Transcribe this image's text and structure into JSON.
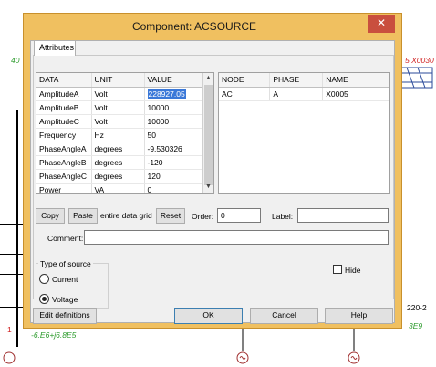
{
  "background": {
    "left_top_label": "40",
    "right_top_label_red": "5  X0030",
    "right_bottom_label_1": "220-2",
    "right_bottom_label_2": "3E9",
    "left_bottom_label": "-6.E6+j6.8E5",
    "left_marker": "1"
  },
  "dialog": {
    "title": "Component: ACSOURCE",
    "close_glyph": "✕",
    "tab_label": "Attributes",
    "data_grid": {
      "columns": [
        "DATA",
        "UNIT",
        "VALUE"
      ],
      "rows": [
        {
          "data": "AmplitudeA",
          "unit": "Volt",
          "value": "228927.05"
        },
        {
          "data": "AmplitudeB",
          "unit": "Volt",
          "value": "10000"
        },
        {
          "data": "AmplitudeC",
          "unit": "Volt",
          "value": "10000"
        },
        {
          "data": "Frequency",
          "unit": "Hz",
          "value": "50"
        },
        {
          "data": "PhaseAngleA",
          "unit": "degrees",
          "value": "-9.530326"
        },
        {
          "data": "PhaseAngleB",
          "unit": "degrees",
          "value": "-120"
        },
        {
          "data": "PhaseAngleC",
          "unit": "degrees",
          "value": "120"
        },
        {
          "data": "Power",
          "unit": "VA",
          "value": "0"
        }
      ]
    },
    "node_grid": {
      "columns": [
        "NODE",
        "PHASE",
        "NAME"
      ],
      "rows": [
        {
          "node": "AC",
          "phase": "A",
          "name": "X0005"
        }
      ]
    },
    "copy_label": "Copy",
    "paste_label": "Paste",
    "paste_suffix": "entire data grid",
    "reset_label": "Reset",
    "order_label": "Order:",
    "order_value": "0",
    "label_label": "Label:",
    "label_value": "",
    "comment_label": "Comment:",
    "comment_value": "",
    "source_group_label": "Type of source",
    "source_options": [
      {
        "label": "Current",
        "selected": false
      },
      {
        "label": "Voltage",
        "selected": true
      }
    ],
    "hide_label": "Hide",
    "hide_checked": false,
    "edit_definitions_label": "Edit definitions",
    "ok_label": "OK",
    "cancel_label": "Cancel",
    "help_label": "Help"
  },
  "colors": {
    "dialog_frame": "#f0c060",
    "close_button": "#c94f3e",
    "selection": "#3a78d8",
    "schematic_green": "#2a9a2a",
    "schematic_red": "#d02020"
  }
}
